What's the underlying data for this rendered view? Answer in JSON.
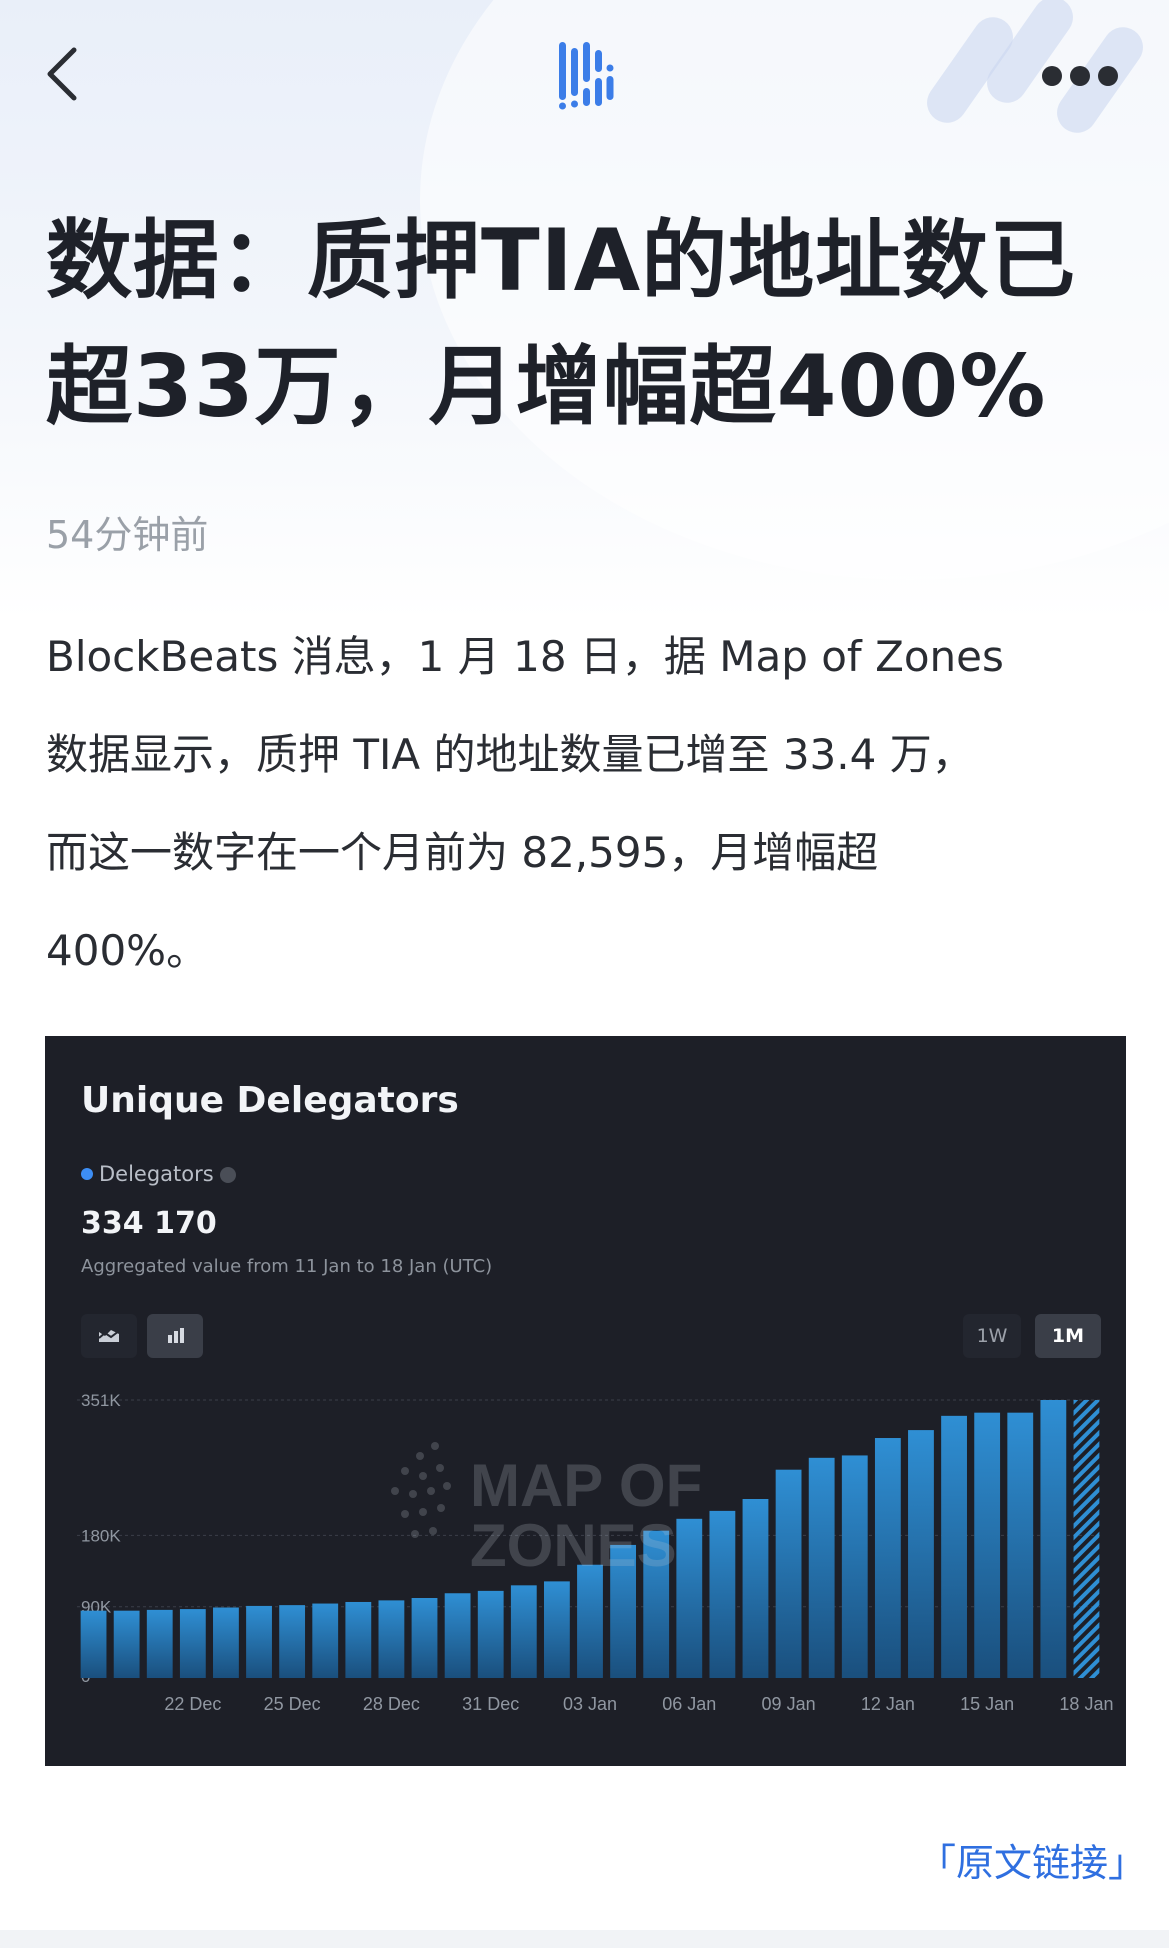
{
  "header": {
    "back_icon": "chevron-left-icon",
    "logo_icon": "blockbeats-logo-icon",
    "more_icon": "more-dots-icon",
    "accent_color": "#3b7de8"
  },
  "article": {
    "title_line1": "数据：质押TIA的地址数已",
    "title_line2": "超33万，月增幅超400%",
    "time": "54分钟前",
    "body_lines": [
      "BlockBeats 消息，1 月 18 日，据 Map of Zones",
      "数据显示，质押 TIA 的地址数量已增至 33.4 万，",
      "而这一数字在一个月前为 82,595，月增幅超",
      "400%。"
    ],
    "original_link": "「原文链接」"
  },
  "chart_card": {
    "title": "Unique Delegators",
    "legend_label": "Delegators",
    "value": "334 170",
    "aggregated_note": "Aggregated value from 11 Jan to 18 Jan (UTC)",
    "toggle_area_icon": "area-chart-icon",
    "toggle_bar_icon": "bar-chart-icon",
    "range_1w": "1W",
    "range_1m": "1M",
    "watermark_line1": "MAP OF",
    "watermark_line2": "ZONES",
    "bar_color": "#2a7fc0",
    "background_color": "#1d1f27"
  },
  "chart_data": {
    "type": "bar",
    "title": "Unique Delegators",
    "series": [
      {
        "name": "Delegators",
        "values": [
          85000,
          85000,
          86000,
          87000,
          89000,
          91000,
          92000,
          94000,
          96000,
          98000,
          101000,
          107000,
          110000,
          117000,
          122000,
          143000,
          168000,
          186000,
          201000,
          211000,
          226000,
          263000,
          278000,
          281000,
          303000,
          313000,
          331000,
          335000,
          335000,
          351000,
          351000
        ]
      }
    ],
    "x_tick_labels": [
      "22 Dec",
      "25 Dec",
      "28 Dec",
      "31 Dec",
      "03 Jan",
      "06 Jan",
      "09 Jan",
      "12 Jan",
      "15 Jan",
      "18 Jan"
    ],
    "x_tick_indices": [
      3,
      6,
      9,
      12,
      15,
      18,
      21,
      24,
      27,
      30
    ],
    "y_tick_labels": [
      "0",
      "90K",
      "180K",
      "351K"
    ],
    "y_tick_values": [
      0,
      90000,
      180000,
      351000
    ],
    "ylim": [
      0,
      351000
    ],
    "last_bar_partial": true,
    "grid": true
  }
}
